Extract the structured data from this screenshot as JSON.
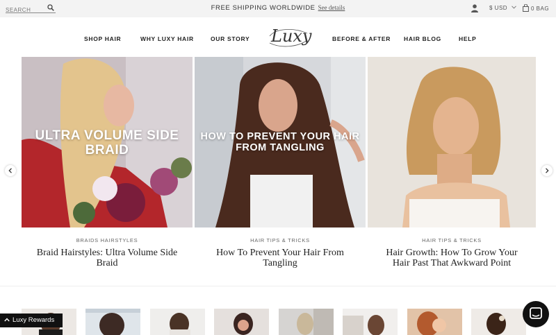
{
  "topbar": {
    "search_placeholder": "SEARCH",
    "promo_text": "FREE SHIPPING WORLDWIDE",
    "promo_link": "See details",
    "currency": "$ USD",
    "bag_label": "0 BAG"
  },
  "nav": {
    "items": [
      "SHOP HAIR",
      "WHY LUXY HAIR",
      "OUR STORY",
      "BEFORE & AFTER",
      "HAIR BLOG",
      "HELP"
    ],
    "logo_text": "Luxy"
  },
  "posts": [
    {
      "overlay": "ULTRA VOLUME SIDE BRAID",
      "category": "BRAIDS HAIRSTYLES",
      "title": "Braid Hairstyles: Ultra Volume Side Braid"
    },
    {
      "overlay": "HOW TO PREVENT YOUR HAIR FROM TANGLING",
      "category": "HAIR TIPS & TRICKS",
      "title": "How To Prevent Your Hair From Tangling"
    },
    {
      "overlay": "",
      "category": "HAIR TIPS & TRICKS",
      "title": "Hair Growth: How To Grow Your Hair Past That Awkward Point"
    }
  ],
  "carousel": {
    "prev_icon": "chevron-left-icon",
    "next_icon": "chevron-right-icon"
  },
  "rewards": {
    "label": "Luxy Rewards",
    "icon": "chevron-up-icon"
  },
  "chat": {
    "icon": "chat-bubble-icon"
  },
  "colors": {
    "topbar_bg": "#f3f3f3",
    "rewards_bg": "#111111",
    "chat_bg": "#111111"
  }
}
